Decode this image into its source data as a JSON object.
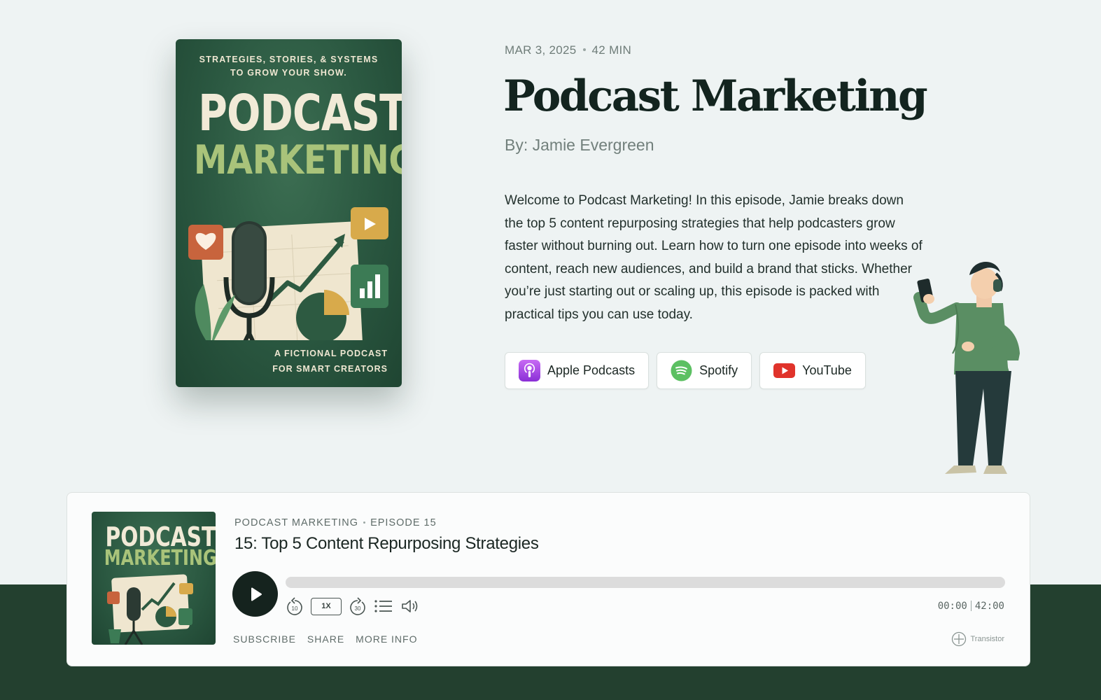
{
  "cover": {
    "tagline": "STRATEGIES, STORIES, & SYSTEMS\nTO GROW YOUR SHOW.",
    "title_line1": "PODCAST",
    "title_line2": "MARKETING",
    "footer": "A FICTIONAL PODCAST\nFOR SMART CREATORS"
  },
  "episode": {
    "date": "MAR 3, 2025",
    "duration": "42 MIN",
    "title": "Podcast Marketing",
    "byline": "By: Jamie Evergreen",
    "description": "Welcome to Podcast Marketing! In this episode, Jamie breaks down the top 5 content repurposing strategies that help podcasters grow faster without burning out. Learn how to turn one episode into weeks of content, reach new audiences, and build a brand that sticks. Whether you’re just starting out or scaling up, this episode is packed with practical tips you can use today."
  },
  "platforms": [
    {
      "label": "Apple Podcasts",
      "icon": "apple-podcasts-icon",
      "color": "#a24ee8"
    },
    {
      "label": "Spotify",
      "icon": "spotify-icon",
      "color": "#1ed760"
    },
    {
      "label": "YouTube",
      "icon": "youtube-icon",
      "color": "#e0332b"
    }
  ],
  "player": {
    "thumb_title_line1": "PODCAST",
    "thumb_title_line2": "MARKETING",
    "show_name": "PODCAST MARKETING",
    "episode_number": "EPISODE 15",
    "episode_title": "15: Top 5 Content Repurposing Strategies",
    "progress": 0,
    "speed": "1X",
    "rewind_seconds": "10",
    "forward_seconds": "30",
    "current_time": "00:00",
    "total_time": "42:00",
    "links": {
      "subscribe": "SUBSCRIBE",
      "share": "SHARE",
      "more_info": "MORE INFO"
    },
    "brand": "Transistor"
  },
  "colors": {
    "accent": "#23402f",
    "dark": "#15231e",
    "background": "#eef3f3"
  }
}
